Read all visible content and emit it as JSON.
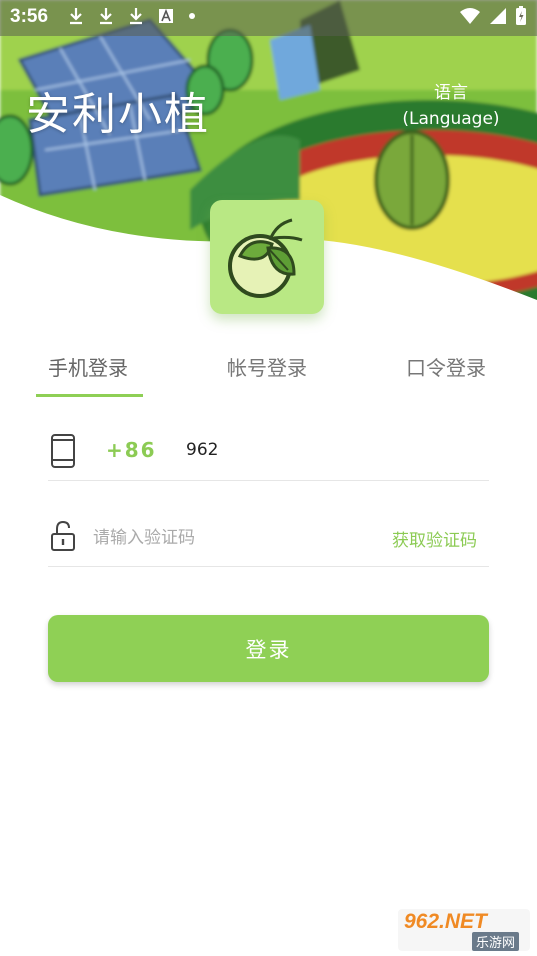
{
  "status_bar": {
    "time": "3:56",
    "left_icons": [
      "download-icon",
      "download-icon",
      "download-icon",
      "font-icon",
      "dot-icon"
    ],
    "right_icons": [
      "wifi-icon",
      "signal-icon",
      "battery-charging-icon"
    ]
  },
  "header": {
    "app_title": "安利小植",
    "language_line1": "语言",
    "language_line2": "(Language)"
  },
  "tabs": [
    {
      "label": "手机登录",
      "active": true
    },
    {
      "label": "帐号登录",
      "active": false
    },
    {
      "label": "口令登录",
      "active": false
    }
  ],
  "form": {
    "country_code": "+86",
    "phone_value": "962",
    "code_placeholder": "请输入验证码",
    "get_code_label": "获取验证码",
    "login_label": "登录"
  },
  "watermark": {
    "brand": "962.NET",
    "subtext": "乐游网"
  },
  "colors": {
    "accent": "#8fd055",
    "accent_text": "#8ccb54",
    "logo_bg": "#b9e884"
  }
}
